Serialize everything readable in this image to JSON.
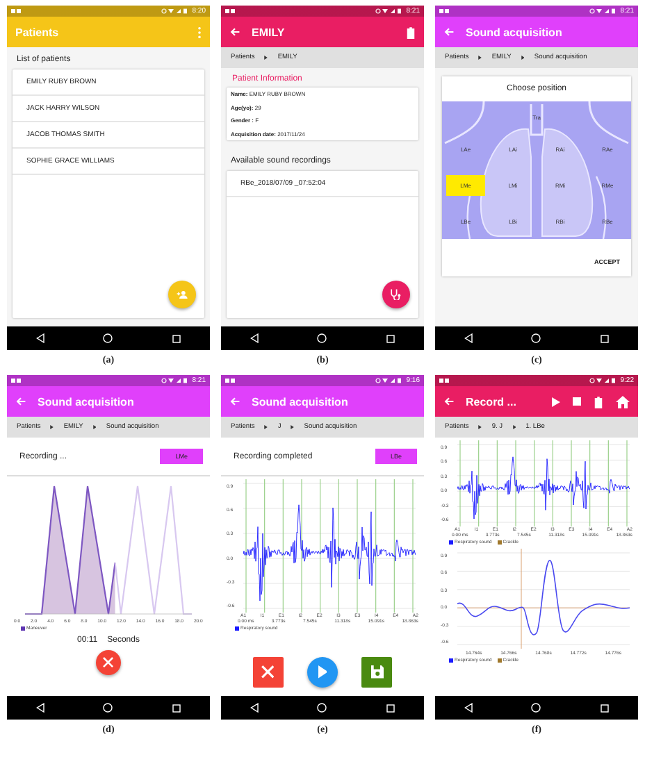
{
  "panels": [
    {
      "caption": "(a)",
      "kind": "patient_list",
      "status_time": "8:20",
      "app_bar": {
        "title": "Patients",
        "color": "#f5c518",
        "back": false,
        "actions": [
          {
            "kind": "more"
          }
        ]
      },
      "list_header": "List of patients",
      "patients": [
        "EMILY RUBY BROWN",
        "JACK HARRY WILSON",
        "JACOB THOMAS SMITH",
        "SOPHIE GRACE WILLIAMS"
      ],
      "fab": {
        "kind": "add_person",
        "color": "#f5c518"
      }
    },
    {
      "caption": "(b)",
      "kind": "patient_detail",
      "status_time": "8:21",
      "app_bar": {
        "title": "EMILY",
        "color": "#e91e63",
        "back": true,
        "actions": [
          {
            "kind": "delete"
          }
        ]
      },
      "breadcrumb": [
        "Patients",
        "EMILY"
      ],
      "section_title": "Patient Information",
      "info": [
        "**Name:** EMILY RUBY BROWN",
        "**Age(yo):** 29",
        "**Gender :** F",
        "**Acquisition date:** 2017/11/24"
      ],
      "recordings_header": "Available sound recordings",
      "recordings": [
        "RBe_2018/07/09 _07:52:04"
      ],
      "fab": {
        "kind": "stethoscope",
        "color": "#e91e63"
      }
    },
    {
      "caption": "(c)",
      "kind": "choose_position",
      "status_time": "8:21",
      "app_bar": {
        "title": "Sound acquisition",
        "color": "#e040fb",
        "back": true
      },
      "breadcrumb": [
        "Patients",
        "EMILY",
        "Sound acquisition"
      ],
      "dialog_title": "Choose position",
      "positions": [
        {
          "label": "Tra",
          "selected": false
        },
        {
          "label": "LAe",
          "selected": false
        },
        {
          "label": "LAi",
          "selected": false
        },
        {
          "label": "RAi",
          "selected": false
        },
        {
          "label": "RAe",
          "selected": false
        },
        {
          "label": "LMe",
          "selected": true
        },
        {
          "label": "LMi",
          "selected": false
        },
        {
          "label": "RMi",
          "selected": false
        },
        {
          "label": "RMe",
          "selected": false
        },
        {
          "label": "LBe",
          "selected": false
        },
        {
          "label": "LBi",
          "selected": false
        },
        {
          "label": "RBi",
          "selected": false
        },
        {
          "label": "RBe",
          "selected": false
        }
      ],
      "accept": "ACCEPT"
    },
    {
      "caption": "(d)",
      "kind": "recording",
      "status_time": "8:21",
      "app_bar": {
        "title": "Sound acquisition",
        "color": "#e040fb",
        "back": true
      },
      "breadcrumb": [
        "Patients",
        "EMILY",
        "Sound acquisition"
      ],
      "status_text": "Recording ...",
      "badge": "LMe",
      "x_ticks": [
        "0.0",
        "2.0",
        "4.0",
        "6.0",
        "8.0",
        "10.0",
        "12.0",
        "14.0",
        "16.0",
        "18.0",
        "20.0"
      ],
      "legend": [
        {
          "label": "Maneuver",
          "color": "#5e35b1"
        }
      ],
      "timer": "00:11",
      "timer_unit": "Seconds",
      "fab": {
        "kind": "cancel",
        "color": "#f44336"
      }
    },
    {
      "caption": "(e)",
      "kind": "completed",
      "status_time": "9:16",
      "app_bar": {
        "title": "Sound acquisition",
        "color": "#e040fb",
        "back": true
      },
      "breadcrumb": [
        "Patients",
        "J",
        "Sound acquisition"
      ],
      "status_text": "Recording completed",
      "badge": "LBe",
      "wave": {
        "y_ticks": [
          "0.9",
          "0.6",
          "0.3",
          "0.0",
          "-0.3",
          "-0.6"
        ],
        "phase_labels": [
          "A1",
          "I1",
          "E1",
          "I2",
          "E2",
          "I3",
          "E3",
          "I4",
          "E4",
          "A2"
        ],
        "time_labels": [
          "0.00 ms",
          "3.773s",
          "7.545s",
          "11.318s",
          "15.091s",
          "18.863s"
        ],
        "legend": [
          {
            "label": "Respiratory sound",
            "color": "#1a1aff"
          }
        ]
      },
      "buttons": [
        {
          "kind": "cancel",
          "color": "#f44336"
        },
        {
          "kind": "play",
          "color": "#2196f3"
        },
        {
          "kind": "save",
          "color": "#4a8a10"
        }
      ]
    },
    {
      "caption": "(f)",
      "kind": "review",
      "status_time": "9:22",
      "app_bar": {
        "title": "Record ...",
        "color": "#e91e63",
        "back": true,
        "actions": [
          {
            "kind": "play"
          },
          {
            "kind": "stop"
          },
          {
            "kind": "delete"
          },
          {
            "kind": "home"
          }
        ]
      },
      "breadcrumb": [
        "Patients",
        "9. J",
        "1. LBe"
      ],
      "wave": {
        "y_ticks": [
          "0.9",
          "0.6",
          "0.3",
          "0.0",
          "-0.3",
          "-0.6"
        ],
        "phase_labels": [
          "A1",
          "I1",
          "E1",
          "I2",
          "E2",
          "I3",
          "E3",
          "I4",
          "E4",
          "A2"
        ],
        "time_labels": [
          "0.00 ms",
          "3.773s",
          "7.545s",
          "11.318s",
          "15.091s",
          "18.863s"
        ],
        "legend": [
          {
            "label": "Respiratory sound",
            "color": "#1a1aff"
          },
          {
            "label": "Crackle",
            "color": "#a0782c"
          }
        ]
      },
      "zoom": {
        "y_ticks": [
          "0.9",
          "0.6",
          "0.3",
          "0.0",
          "-0.3",
          "-0.6"
        ],
        "x_ticks": [
          "14.764s",
          "14.766s",
          "14.768s",
          "14.772s",
          "14.776s"
        ],
        "legend": [
          {
            "label": "Respiratory sound",
            "color": "#1a1aff"
          },
          {
            "label": "Crackle",
            "color": "#a0782c"
          }
        ]
      }
    }
  ]
}
